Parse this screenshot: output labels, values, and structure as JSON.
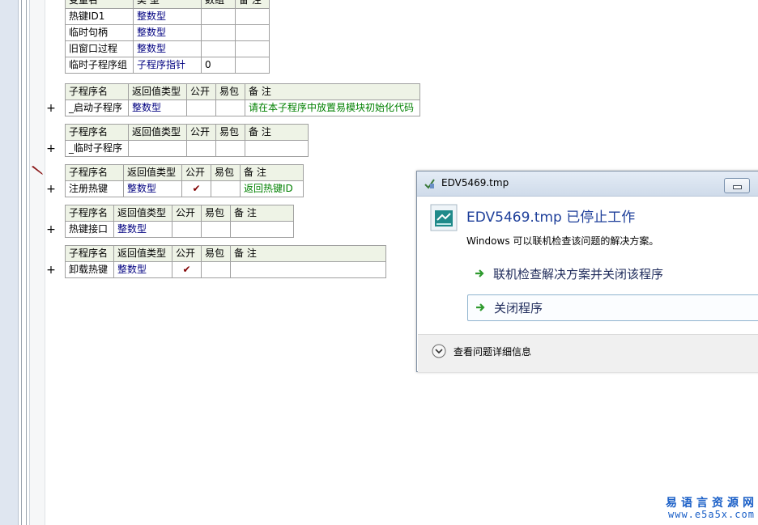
{
  "var_table": {
    "headers": [
      "变量名",
      "类 型",
      "数组",
      "备 注"
    ],
    "rows": [
      {
        "name": "热键ID1",
        "type": "整数型",
        "array": "",
        "note": ""
      },
      {
        "name": "临时句柄",
        "type": "整数型",
        "array": "",
        "note": ""
      },
      {
        "name": "旧窗口过程",
        "type": "整数型",
        "array": "",
        "note": ""
      },
      {
        "name": "临时子程序组",
        "type": "子程序指针",
        "array": "0",
        "note": ""
      }
    ]
  },
  "sub_headers": [
    "子程序名",
    "返回值类型",
    "公开",
    "易包",
    "备 注"
  ],
  "subs": [
    {
      "name": "_启动子程序",
      "ret": "整数型",
      "public": "",
      "pkg": "",
      "note": "请在本子程序中放置易模块初始化代码"
    },
    {
      "name": "_临时子程序",
      "ret": "",
      "public": "",
      "pkg": "",
      "note": ""
    },
    {
      "name": "注册热键",
      "ret": "整数型",
      "public": "✔",
      "pkg": "",
      "note": "返回热键ID"
    },
    {
      "name": "热键接口",
      "ret": "整数型",
      "public": "",
      "pkg": "",
      "note": ""
    },
    {
      "name": "卸载热键",
      "ret": "整数型",
      "public": "✔",
      "pkg": "",
      "note": ""
    }
  ],
  "expand_symbol": "+",
  "dialog": {
    "title": "EDV5469.tmp",
    "heading": "EDV5469.tmp 已停止工作",
    "subtext": "Windows 可以联机检查该问题的解决方案。",
    "option1": "联机检查解决方案并关闭该程序",
    "option2": "关闭程序",
    "details": "查看问题详细信息"
  },
  "watermark": {
    "line1": "易语言资源网",
    "line2": "www.e5a5x.com"
  },
  "colors": {
    "header_bg": "#eef3e6",
    "type_blue": "#000080",
    "note_green": "#008000",
    "dialog_heading": "#1e3f9a",
    "watermark": "#1a5fc7"
  }
}
